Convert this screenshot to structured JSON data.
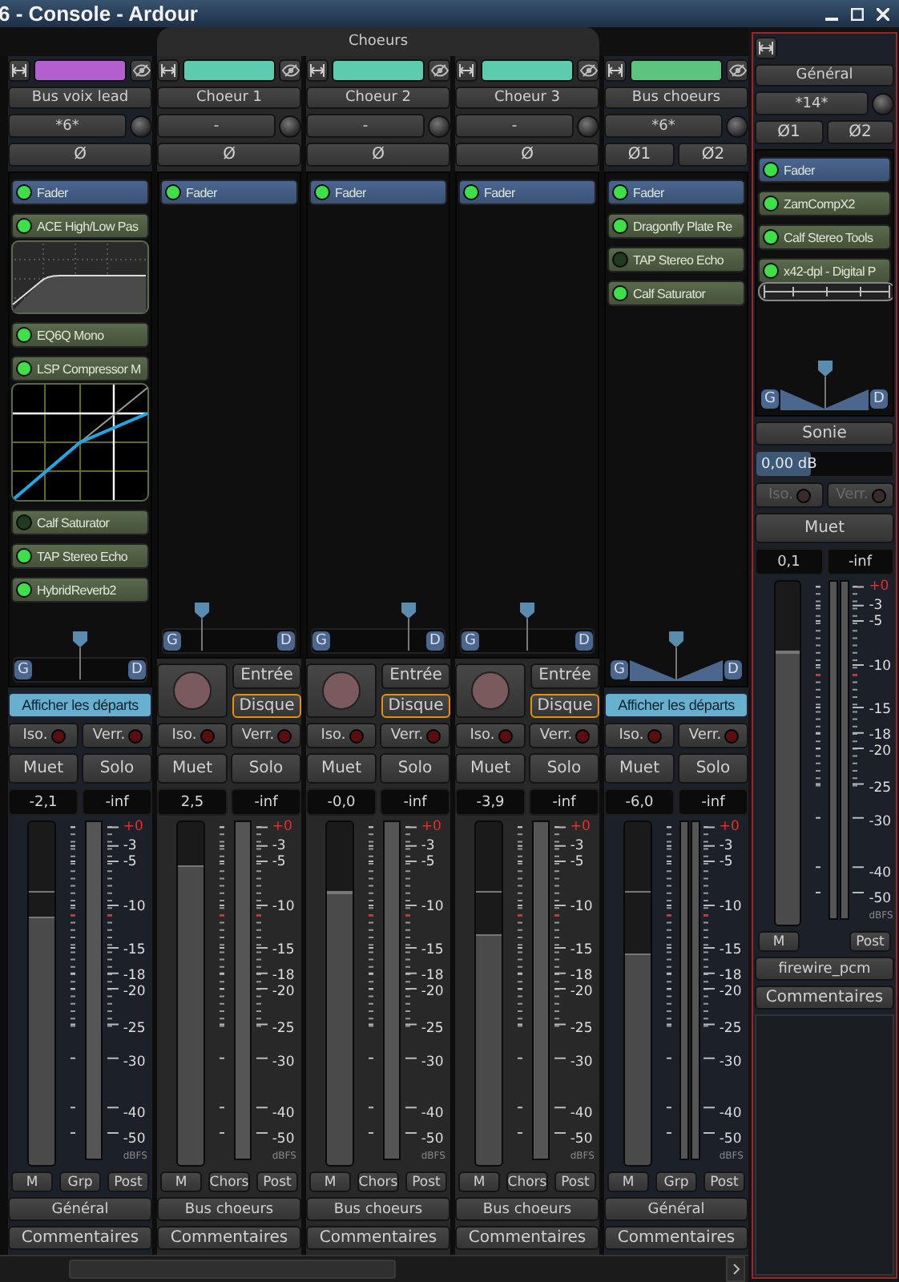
{
  "window": {
    "title": "6 - Console - Ardour"
  },
  "group_bar": [
    {
      "kind": "none"
    },
    {
      "kind": "group",
      "label": "Choeurs"
    },
    {
      "kind": "continued"
    },
    {
      "kind": "continued"
    },
    {
      "kind": "none"
    }
  ],
  "strips": [
    {
      "kind": "bus",
      "name": "Bus voix lead",
      "color": "#b45fd0",
      "input": "*6*",
      "polarity": [
        "Ø"
      ],
      "processors": [
        {
          "kind": "fader",
          "name": "Fader",
          "active": true
        },
        {
          "kind": "plugin",
          "name": "ACE High/Low Pas",
          "active": true,
          "display": {
            "kind": "filter"
          }
        },
        {
          "kind": "plugin",
          "name": "EQ6Q Mono",
          "active": true
        },
        {
          "kind": "plugin",
          "name": "LSP Compressor M",
          "active": true,
          "display": {
            "kind": "compressor"
          }
        },
        {
          "kind": "plugin",
          "name": "Calf Saturator",
          "active": false
        },
        {
          "kind": "plugin",
          "name": "TAP Stereo Echo",
          "active": true
        },
        {
          "kind": "plugin",
          "name": "HybridReverb2",
          "active": true
        }
      ],
      "panner": {
        "kind": "mono",
        "left": "G",
        "right": "D",
        "level": 0.5
      },
      "sends": {
        "label": "Afficher les départs",
        "selected": true
      },
      "isolate": {
        "label": "Iso.",
        "on": false,
        "disabled": false
      },
      "lock": {
        "label": "Verr.",
        "on": false,
        "disabled": false
      },
      "mute": "Muet",
      "solo": "Solo",
      "gain": "-2,1",
      "peak": "-inf",
      "fader": {
        "level": 0.72
      },
      "meter": {
        "kind": "mono"
      },
      "scale": [
        "+0",
        "-3",
        "-5",
        "-10",
        "-15",
        "-18",
        "-20",
        "-25",
        "-30",
        "-40",
        "-50",
        "dBFS"
      ],
      "meter_buttons": [
        "M",
        "Grp",
        "Post"
      ],
      "group": "Général",
      "comments": "Commentaires"
    },
    {
      "kind": "track",
      "name": "Choeur 1",
      "color": "#5ccbae",
      "input": "-",
      "polarity": [
        "Ø"
      ],
      "processors": [
        {
          "kind": "fader",
          "name": "Fader",
          "active": true
        }
      ],
      "panner": {
        "kind": "mono",
        "left": "G",
        "right": "D",
        "level": 0.3
      },
      "rec": {
        "armed": false
      },
      "monitor_input": {
        "label": "Entrée",
        "selected": false
      },
      "monitor_disk": {
        "label": "Disque",
        "selected": true
      },
      "isolate": {
        "label": "Iso.",
        "on": false,
        "disabled": false
      },
      "lock": {
        "label": "Verr.",
        "on": false,
        "disabled": false
      },
      "mute": "Muet",
      "solo": "Solo",
      "gain": "2,5",
      "peak": "-inf",
      "fader": {
        "level": 0.87
      },
      "meter": {
        "kind": "mono"
      },
      "scale": [
        "+0",
        "-3",
        "-5",
        "-10",
        "-15",
        "-18",
        "-20",
        "-25",
        "-30",
        "-40",
        "-50",
        "dBFS"
      ],
      "meter_buttons": [
        "M",
        "Chors",
        "Post"
      ],
      "group": "Bus choeurs",
      "comments": "Commentaires"
    },
    {
      "kind": "track",
      "name": "Choeur 2",
      "color": "#5ccbae",
      "input": "-",
      "polarity": [
        "Ø"
      ],
      "processors": [
        {
          "kind": "fader",
          "name": "Fader",
          "active": true
        }
      ],
      "panner": {
        "kind": "mono",
        "left": "G",
        "right": "D",
        "level": 0.72
      },
      "rec": {
        "armed": false
      },
      "monitor_input": {
        "label": "Entrée",
        "selected": false
      },
      "monitor_disk": {
        "label": "Disque",
        "selected": true
      },
      "isolate": {
        "label": "Iso.",
        "on": false,
        "disabled": false
      },
      "lock": {
        "label": "Verr.",
        "on": false,
        "disabled": false
      },
      "mute": "Muet",
      "solo": "Solo",
      "gain": "-0,0",
      "peak": "-inf",
      "fader": {
        "level": 0.79
      },
      "meter": {
        "kind": "mono"
      },
      "scale": [
        "+0",
        "-3",
        "-5",
        "-10",
        "-15",
        "-18",
        "-20",
        "-25",
        "-30",
        "-40",
        "-50",
        "dBFS"
      ],
      "meter_buttons": [
        "M",
        "Chors",
        "Post"
      ],
      "group": "Bus choeurs",
      "comments": "Commentaires"
    },
    {
      "kind": "track",
      "name": "Choeur 3",
      "color": "#5ccbae",
      "input": "-",
      "polarity": [
        "Ø"
      ],
      "processors": [
        {
          "kind": "fader",
          "name": "Fader",
          "active": true
        }
      ],
      "panner": {
        "kind": "mono",
        "left": "G",
        "right": "D",
        "level": 0.5
      },
      "rec": {
        "armed": false
      },
      "monitor_input": {
        "label": "Entrée",
        "selected": false
      },
      "monitor_disk": {
        "label": "Disque",
        "selected": true
      },
      "isolate": {
        "label": "Iso.",
        "on": false,
        "disabled": false
      },
      "lock": {
        "label": "Verr.",
        "on": false,
        "disabled": false
      },
      "mute": "Muet",
      "solo": "Solo",
      "gain": "-3,9",
      "peak": "-inf",
      "fader": {
        "level": 0.67
      },
      "meter": {
        "kind": "mono"
      },
      "scale": [
        "+0",
        "-3",
        "-5",
        "-10",
        "-15",
        "-18",
        "-20",
        "-25",
        "-30",
        "-40",
        "-50",
        "dBFS"
      ],
      "meter_buttons": [
        "M",
        "Chors",
        "Post"
      ],
      "group": "Bus choeurs",
      "comments": "Commentaires"
    },
    {
      "kind": "bus",
      "name": "Bus choeurs",
      "color": "#5cc47e",
      "input": "*6*",
      "polarity": [
        "Ø1",
        "Ø2"
      ],
      "processors": [
        {
          "kind": "fader",
          "name": "Fader",
          "active": true
        },
        {
          "kind": "plugin",
          "name": "Dragonfly Plate Re",
          "active": true
        },
        {
          "kind": "plugin",
          "name": "TAP Stereo Echo",
          "active": false
        },
        {
          "kind": "plugin",
          "name": "Calf Saturator",
          "active": true
        }
      ],
      "panner": {
        "kind": "stereo",
        "left": "G",
        "right": "D",
        "level": 0.5
      },
      "sends": {
        "label": "Afficher les départs",
        "selected": true
      },
      "isolate": {
        "label": "Iso.",
        "on": false,
        "disabled": false
      },
      "lock": {
        "label": "Verr.",
        "on": false,
        "disabled": false
      },
      "mute": "Muet",
      "solo": "Solo",
      "gain": "-6,0",
      "peak": "-inf",
      "fader": {
        "level": 0.61
      },
      "meter": {
        "kind": "stereo"
      },
      "scale": [
        "+0",
        "-3",
        "-5",
        "-10",
        "-15",
        "-18",
        "-20",
        "-25",
        "-30",
        "-40",
        "-50",
        "dBFS"
      ],
      "meter_buttons": [
        "M",
        "Grp",
        "Post"
      ],
      "group": "Général",
      "comments": "Commentaires"
    }
  ],
  "master": {
    "name": "Général",
    "input": "*14*",
    "polarity": [
      "Ø1",
      "Ø2"
    ],
    "processors": [
      {
        "kind": "fader",
        "name": "Fader",
        "active": true
      },
      {
        "kind": "plugin",
        "name": "ZamCompX2",
        "active": true
      },
      {
        "kind": "plugin",
        "name": "Calf Stereo Tools",
        "active": true
      },
      {
        "kind": "plugin",
        "name": "x42-dpl - Digital P",
        "active": true,
        "display": {
          "kind": "slider"
        }
      }
    ],
    "panner": {
      "kind": "stereo",
      "left": "G",
      "right": "D",
      "level": 0.5
    },
    "loudness": "Sonie",
    "volume": {
      "reading": "0,00 dB",
      "level": 0.4
    },
    "isolate": {
      "label": "Iso.",
      "on": false,
      "disabled": true
    },
    "lock": {
      "label": "Verr.",
      "on": false,
      "disabled": true
    },
    "mute": "Muet",
    "gain": "0,1",
    "peak": "-inf",
    "fader": {
      "level": 0.79
    },
    "meter": {
      "kind": "stereo"
    },
    "scale": [
      "+0",
      "-3",
      "-5",
      "-10",
      "-15",
      "-18",
      "-20",
      "-25",
      "-30",
      "-40",
      "-50",
      "dBFS"
    ],
    "meter_buttons": [
      "M",
      "Post"
    ],
    "output": "firewire_pcm",
    "comments": "Commentaires"
  }
}
